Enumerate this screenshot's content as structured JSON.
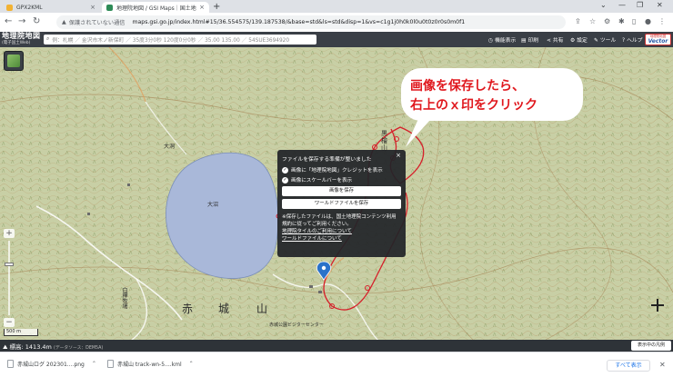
{
  "browser": {
    "tabs": [
      {
        "title": "GPX2KML",
        "active": false
      },
      {
        "title": "地理院地図 / GSI Maps｜国土地…",
        "active": true
      }
    ],
    "new_tab": "+",
    "close_glyph": "×",
    "address": {
      "security_label": "保護されていない通信",
      "url": "maps.gsi.go.jp/index.html#15/36.554575/139.187538/&base=std&ls=std&disp=1&vs=c1g1j0h0k0l0u0t0z0r0s0m0f1"
    }
  },
  "gsi": {
    "logo": {
      "line1": "地理院地図",
      "line2": "(電子国土Web)"
    },
    "search_placeholder": "例：札幌 ／ 金沢市木ノ新保町 ／ 35度3分0秒 120度0分0秒 ／ 35.00 135.00 ／ 54SUE3694920",
    "menu": {
      "screen": "機能表示",
      "print": "印刷",
      "share": "共有",
      "settings": "設定",
      "tools": "ツール",
      "help": "ヘルプ"
    },
    "vector": {
      "line1": "地理院地図",
      "line2": "Vector"
    }
  },
  "map": {
    "labels": {
      "lake": "大沼",
      "oono": "大洞",
      "shirakaba": "白樺牧場",
      "visitor": "赤城公園ビジターセンター",
      "akagi_big": [
        "赤",
        "城",
        "山"
      ],
      "kurobi": "黒檜山"
    },
    "scale": "500 m"
  },
  "dialog": {
    "title": "ファイルを保存する準備が整いました",
    "check_credit": "画像に「地理院地図」クレジットを表示",
    "check_scale": "画像にスケールバーを表示",
    "save_image": "画像を保存",
    "save_world": "ワールドファイルを保存",
    "note": "※保存したファイルは、国土地理院コンテンツ利用規約に従ってご利用ください。",
    "link_tiles": "地理院タイルのご利用について",
    "link_world": "ワールドファイルについて",
    "close": "×"
  },
  "callout": {
    "text": "画像を保存したら、\n右上のｘ印をクリック",
    "color": "#e0181e"
  },
  "footer": {
    "elevation": "標高: 1413.4m",
    "source": "(データソース：DEM5A)",
    "legend": "表示中の凡例"
  },
  "downloads": {
    "items": [
      {
        "name": "赤城山ログ 202301....png"
      },
      {
        "name": "赤城山 track-wn-5....kml"
      }
    ],
    "show_all": "すべて表示"
  }
}
